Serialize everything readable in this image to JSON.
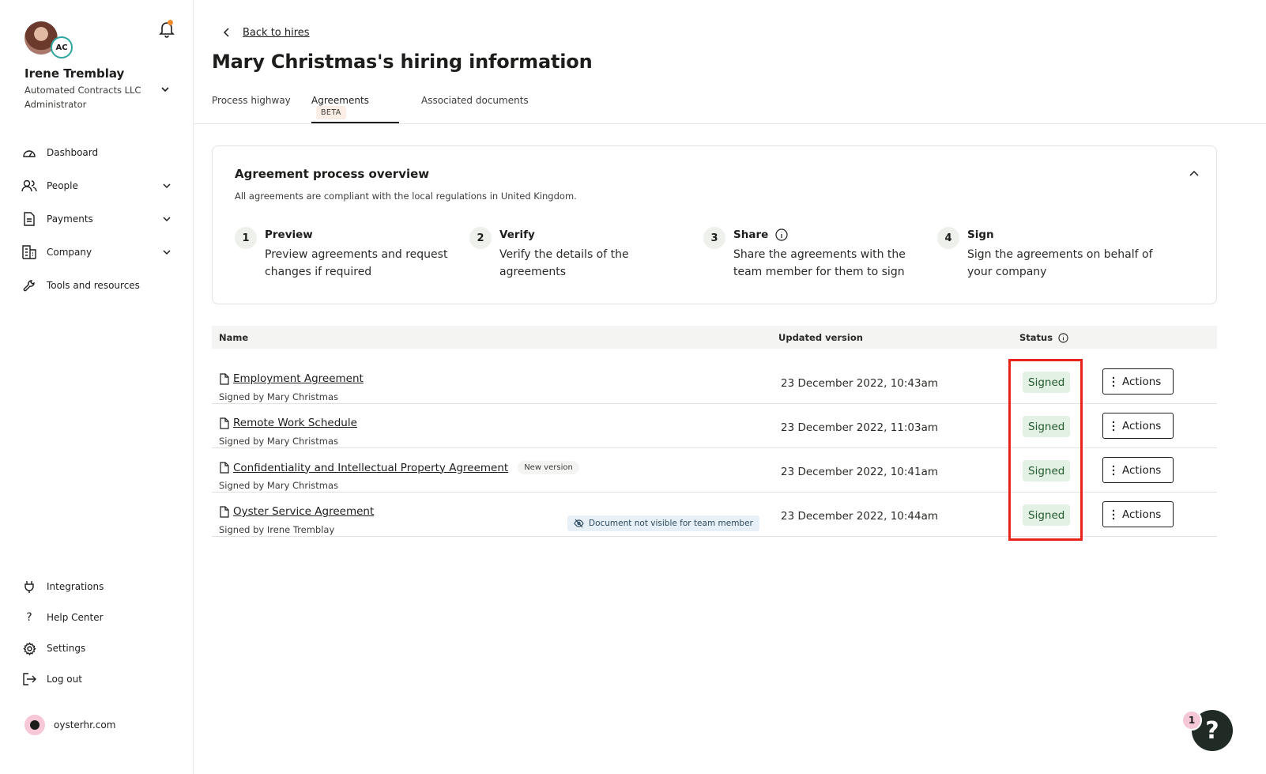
{
  "user": {
    "name": "Irene Tremblay",
    "company": "Automated Contracts LLC",
    "role": "Administrator",
    "badge": "AC"
  },
  "sidebar": {
    "items": [
      {
        "label": "Dashboard",
        "icon": "dashboard-icon"
      },
      {
        "label": "People",
        "icon": "people-icon"
      },
      {
        "label": "Payments",
        "icon": "payments-icon"
      },
      {
        "label": "Company",
        "icon": "company-icon"
      },
      {
        "label": "Tools and resources",
        "icon": "tools-icon"
      }
    ],
    "footer_items": [
      {
        "label": "Integrations",
        "icon": "plug-icon"
      },
      {
        "label": "Help Center",
        "icon": "question-icon"
      },
      {
        "label": "Settings",
        "icon": "gear-icon"
      },
      {
        "label": "Log out",
        "icon": "logout-icon"
      }
    ],
    "site": "oysterhr.com"
  },
  "header": {
    "back_label": "Back to hires",
    "title": "Mary Christmas's hiring information"
  },
  "tabs": [
    {
      "label": "Process highway"
    },
    {
      "label": "Agreements",
      "badge": "BETA",
      "active": true
    },
    {
      "label": "Associated documents"
    }
  ],
  "overview": {
    "title": "Agreement process overview",
    "subtitle": "All agreements are compliant with the local regulations in United Kingdom.",
    "steps": [
      {
        "num": "1",
        "title": "Preview",
        "desc": "Preview agreements and request changes if required"
      },
      {
        "num": "2",
        "title": "Verify",
        "desc": "Verify the details of the agreements"
      },
      {
        "num": "3",
        "title": "Share",
        "desc": "Share the agreements with the team member for them to sign"
      },
      {
        "num": "4",
        "title": "Sign",
        "desc": "Sign the agreements on behalf of your company"
      }
    ]
  },
  "table": {
    "headers": {
      "name": "Name",
      "updated": "Updated version",
      "status": "Status"
    },
    "rows": [
      {
        "name": "Employment Agreement",
        "signed_by": "Signed by Mary Christmas",
        "updated": "23 December 2022, 10:43am",
        "status": "Signed",
        "action": "Actions"
      },
      {
        "name": "Remote Work Schedule",
        "signed_by": "Signed by Mary Christmas",
        "updated": "23 December 2022, 11:03am",
        "status": "Signed",
        "action": "Actions"
      },
      {
        "name": "Confidentiality and Intellectual Property Agreement",
        "tag": "New version",
        "signed_by": "Signed by Mary Christmas",
        "updated": "23 December 2022, 10:41am",
        "status": "Signed",
        "action": "Actions"
      },
      {
        "name": "Oyster Service Agreement",
        "notice": "Document not visible for team member",
        "signed_by": "Signed by Irene Tremblay",
        "updated": "23 December 2022, 10:44am",
        "status": "Signed",
        "action": "Actions"
      }
    ]
  },
  "help": {
    "count": "1",
    "symbol": "?"
  },
  "colors": {
    "status_signed_bg": "#e2f1e4",
    "status_signed_text": "#24592f",
    "highlight": "#e8231b",
    "notification_dot": "#f28a2e"
  }
}
